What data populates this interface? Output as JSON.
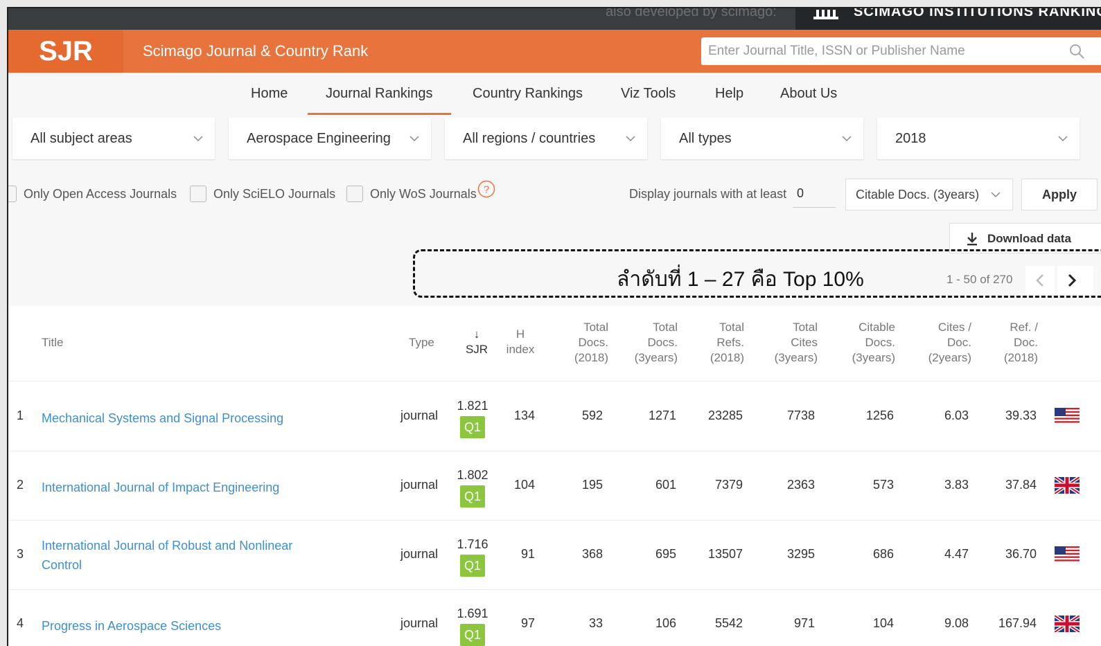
{
  "topbar": {
    "developed_by": "also developed by scimago:",
    "sir_label": "SCIMAGO INSTITUTIONS RANKINGS"
  },
  "header": {
    "logo": "SJR",
    "brand": "Scimago Journal & Country Rank",
    "search_placeholder": "Enter Journal Title, ISSN or Publisher Name"
  },
  "nav": {
    "items": [
      "Home",
      "Journal Rankings",
      "Country Rankings",
      "Viz Tools",
      "Help",
      "About Us"
    ],
    "active": "Journal Rankings"
  },
  "dropdowns": {
    "subject_area": "All subject areas",
    "subject_category": "Aerospace Engineering",
    "region": "All regions / countries",
    "type": "All types",
    "year": "2018"
  },
  "filters": {
    "open_access": "Only Open Access Journals",
    "scielo": "Only SciELO Journals",
    "wos": "Only WoS Journals",
    "min_label": "Display journals with at least",
    "min_value": "0",
    "citable_select": "Citable Docs. (3years)",
    "apply": "Apply"
  },
  "download": "Download data",
  "annotation": "ลำดับที่ 1 – 27 คือ Top 10%",
  "pager": {
    "text": "1 - 50 of 270"
  },
  "table": {
    "headers": {
      "title": "Title",
      "type": "Type",
      "sjr_arrow": "↓",
      "sjr": "SJR",
      "h1": "H",
      "h2": "index",
      "td1": "Total",
      "td2": "Docs.",
      "td3": "(2018)",
      "t3_1": "Total",
      "t3_2": "Docs.",
      "t3_3": "(3years)",
      "tr1": "Total",
      "tr2": "Refs.",
      "tr3": "(2018)",
      "tc1": "Total",
      "tc2": "Cites",
      "tc3": "(3years)",
      "cd1": "Citable",
      "cd2": "Docs.",
      "cd3": "(3years)",
      "cp1": "Cites /",
      "cp2": "Doc.",
      "cp3": "(2years)",
      "rp1": "Ref. /",
      "rp2": "Doc.",
      "rp3": "(2018)"
    },
    "rows": [
      {
        "rank": "1",
        "title": "Mechanical Systems and Signal Processing",
        "type": "journal",
        "sjr": "1.821",
        "quartile": "Q1",
        "h_index": "134",
        "total_docs_2018": "592",
        "total_docs_3y": "1271",
        "total_refs": "23285",
        "total_cites_3y": "7738",
        "citable_docs_3y": "1256",
        "cites_per_doc": "6.03",
        "ref_per_doc": "39.33",
        "flag": "usa"
      },
      {
        "rank": "2",
        "title": "International Journal of Impact Engineering",
        "type": "journal",
        "sjr": "1.802",
        "quartile": "Q1",
        "h_index": "104",
        "total_docs_2018": "195",
        "total_docs_3y": "601",
        "total_refs": "7379",
        "total_cites_3y": "2363",
        "citable_docs_3y": "573",
        "cites_per_doc": "3.83",
        "ref_per_doc": "37.84",
        "flag": "uk"
      },
      {
        "rank": "3",
        "title": "International Journal of Robust and Nonlinear Control",
        "type": "journal",
        "sjr": "1.716",
        "quartile": "Q1",
        "h_index": "91",
        "total_docs_2018": "368",
        "total_docs_3y": "695",
        "total_refs": "13507",
        "total_cites_3y": "3295",
        "citable_docs_3y": "686",
        "cites_per_doc": "4.47",
        "ref_per_doc": "36.70",
        "flag": "usa"
      },
      {
        "rank": "4",
        "title": "Progress in Aerospace Sciences",
        "type": "journal",
        "sjr": "1.691",
        "quartile": "Q1",
        "h_index": "97",
        "total_docs_2018": "33",
        "total_docs_3y": "106",
        "total_refs": "5542",
        "total_cites_3y": "971",
        "citable_docs_3y": "104",
        "cites_per_doc": "9.08",
        "ref_per_doc": "167.94",
        "flag": "uk"
      }
    ]
  },
  "colors": {
    "orange": "#e9733c",
    "link": "#3f8fd0",
    "q1": "#8cc63f"
  }
}
